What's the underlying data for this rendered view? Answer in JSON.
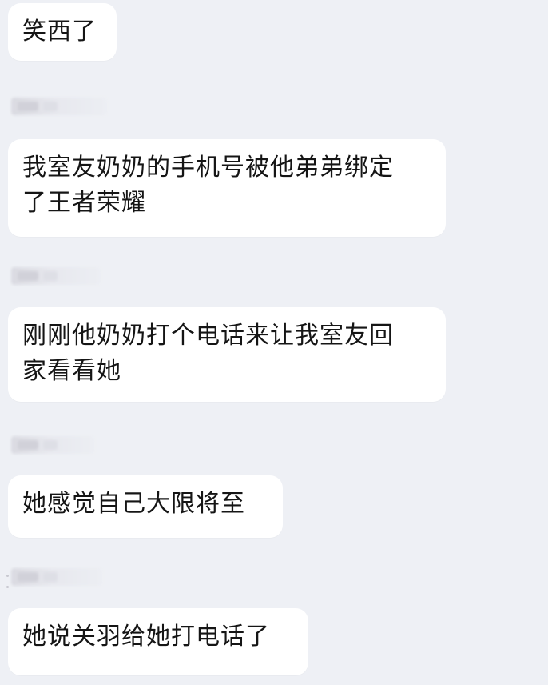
{
  "messages": [
    {
      "text": "笑西了"
    },
    {
      "text": "我室友奶奶的手机号被他弟弟绑定\n了王者荣耀"
    },
    {
      "text": "刚刚他奶奶打个电话来让我室友回\n家看看她"
    },
    {
      "text": "她感觉自己大限将至"
    },
    {
      "text": "她说关羽给她打电话了"
    }
  ]
}
